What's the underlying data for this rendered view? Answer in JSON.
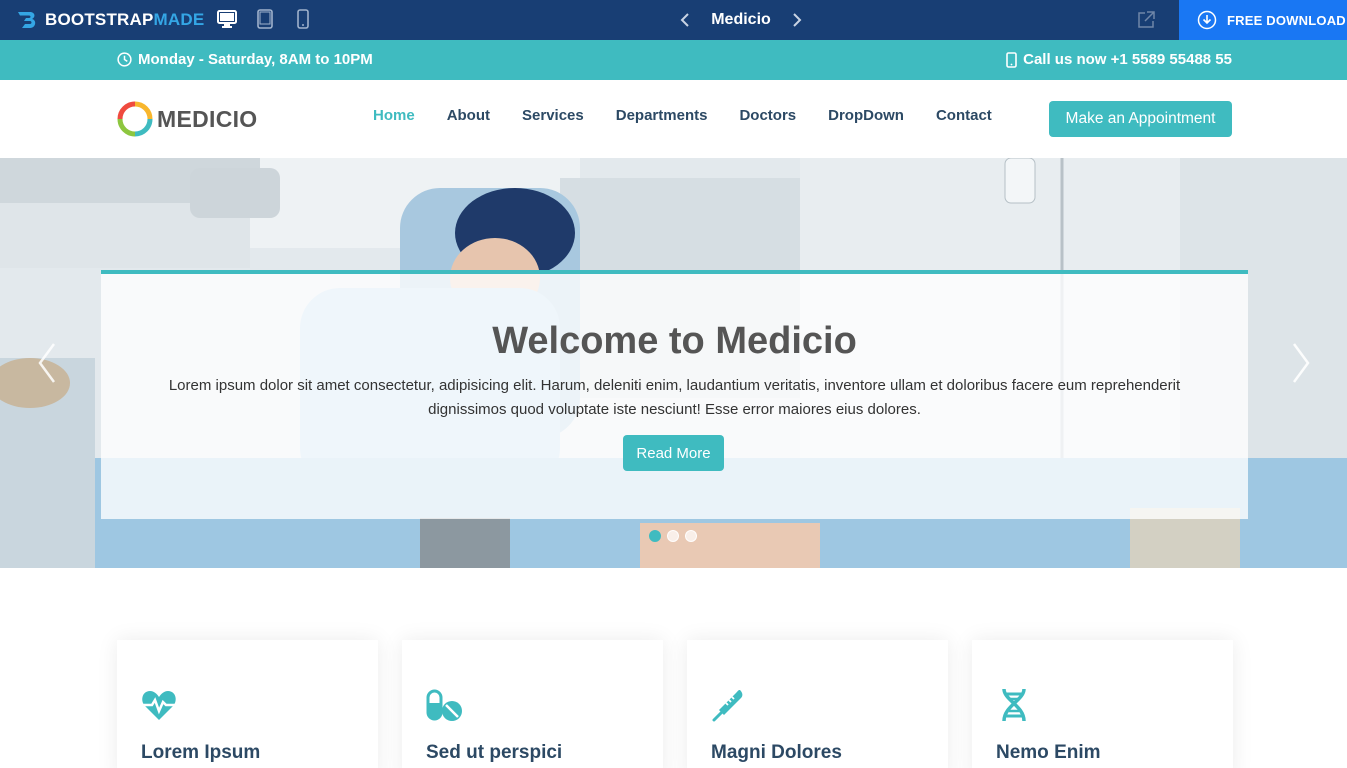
{
  "preview_bar": {
    "logo_text_a": "BOOTSTRAP",
    "logo_text_b": "MADE",
    "devices": [
      "desktop-icon",
      "tablet-icon",
      "mobile-icon"
    ],
    "template_name": "Medicio",
    "download_label": "FREE DOWNLOAD"
  },
  "topbar": {
    "hours": "Monday - Saturday, 8AM to 10PM",
    "phone": "Call us now +1 5589 55488 55"
  },
  "header": {
    "logo": "MEDICIO",
    "nav": [
      {
        "label": "Home",
        "active": true
      },
      {
        "label": "About"
      },
      {
        "label": "Services"
      },
      {
        "label": "Departments"
      },
      {
        "label": "Doctors"
      },
      {
        "label": "DropDown"
      },
      {
        "label": "Contact"
      }
    ],
    "appointment_label": "Make an Appointment"
  },
  "hero": {
    "title": "Welcome to Medicio",
    "text": "Lorem ipsum dolor sit amet consectetur, adipisicing elit. Harum, deleniti enim, laudantium veritatis, inventore ullam et doloribus facere eum reprehenderit dignissimos quod voluptate iste nesciunt! Esse error maiores eius dolores.",
    "button": "Read More",
    "slide_count": 3,
    "active_slide": 1
  },
  "cards": [
    {
      "icon": "heart-pulse-icon",
      "title": "Lorem Ipsum"
    },
    {
      "icon": "pills-icon",
      "title": "Sed ut perspici"
    },
    {
      "icon": "thermometer-icon",
      "title": "Magni Dolores"
    },
    {
      "icon": "dna-icon",
      "title": "Nemo Enim"
    }
  ],
  "colors": {
    "accent": "#3fbbc0",
    "preview_bar": "#183e74",
    "download": "#1977f3",
    "nav_text": "#2c4964"
  }
}
